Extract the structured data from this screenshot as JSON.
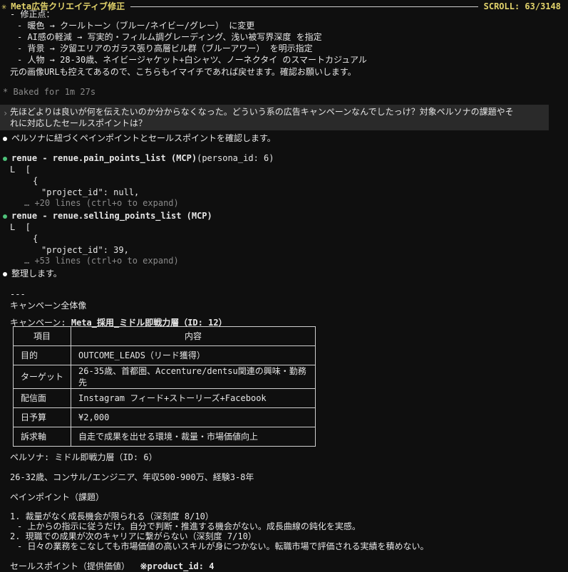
{
  "header": {
    "icon": "sparkle-icon",
    "title": "Meta広告クリエイティブ修正",
    "scroll": "SCROLL:   63/3148"
  },
  "edits": {
    "heading": "- 修正点：",
    "items": [
      "- 暖色 → クールトーン（ブルー/ネイビー/グレー） に変更",
      "- AI感の軽減 → 写実的・フィルム調グレーディング、浅い被写界深度 を指定",
      "- 背景 → 汐留エリアのガラス張り高層ビル群（ブルーアワー） を明示指定",
      "- 人物 → 28-30歳、ネイビージャケット+白シャツ、ノーネクタイ のスマートカジュアル"
    ],
    "note": "元の画像URLも控えてあるので、こちらもイマイチであれば戻せます。確認お願いします。"
  },
  "baked": "* Baked for 1m 27s",
  "user_msg": {
    "line1": "先ほどよりは良いが何を伝えたいのか分からなくなった。どういう系の広告キャンペーンなんでしたっけ？対象ペルソナの課題やそ",
    "line2": "れに対応したセールスポイントは？"
  },
  "assistant1": "ペルソナに紐づくペインポイントとセールスポイントを確認します。",
  "tool1": {
    "name": "renue - renue.pain_points_list (MCP)",
    "args": "(persona_id: 6)",
    "bracket": "L  [",
    "brace": "{",
    "field": "\"project_id\": null,",
    "more": "… +20 lines (ctrl+o to expand)"
  },
  "tool2": {
    "name": "renue - renue.selling_points_list (MCP)",
    "bracket": "L  [",
    "brace": "{",
    "field": "\"project_id\": 39,",
    "more": "… +53 lines (ctrl+o to expand)"
  },
  "assistant2": "整理します。",
  "divider": "---",
  "overview_title": "キャンペーン全体像",
  "campaign": {
    "label": "キャンペーン: ",
    "name": "Meta_採用_ミドル即戦力層（ID: 12）",
    "headers": [
      "項目",
      "内容"
    ],
    "rows": [
      [
        "目的",
        "OUTCOME_LEADS（リード獲得）"
      ],
      [
        "ターゲット",
        "26-35歳、首都圏、Accenture/dentsu関連の興味・勤務先"
      ],
      [
        "配信面",
        "Instagram フィード+ストーリーズ+Facebook"
      ],
      [
        "日予算",
        "¥2,000"
      ],
      [
        "訴求軸",
        "自走で成果を出せる環境・裁量・市場価値向上"
      ]
    ]
  },
  "persona": {
    "title": "ペルソナ: ミドル即戦力層（ID: 6）",
    "desc": "26-32歳、コンサル/エンジニア、年収500-900万、経験3-8年"
  },
  "pain": {
    "title": "ペインポイント（課題）",
    "items": [
      {
        "title": "1. 裁量がなく成長機会が限られる（深刻度 8/10）",
        "detail": "- 上からの指示に従うだけ。自分で判断・推進する機会がない。成長曲線の鈍化を実感。"
      },
      {
        "title": "2. 現職での成果が次のキャリアに繋がらない（深刻度 7/10）",
        "detail": "- 日々の業務をこなしても市場価値の高いスキルが身につかない。転職市場で評価される実績を積めない。"
      }
    ]
  },
  "selling": {
    "title": "セールスポイント（提供価値）",
    "note": "※product_id: 4"
  },
  "colors": {
    "background": "#0f0f0f",
    "accent_yellow": "#e2d36b",
    "tool_green": "#4ec27a",
    "quote_bg": "#2a2a2a"
  }
}
